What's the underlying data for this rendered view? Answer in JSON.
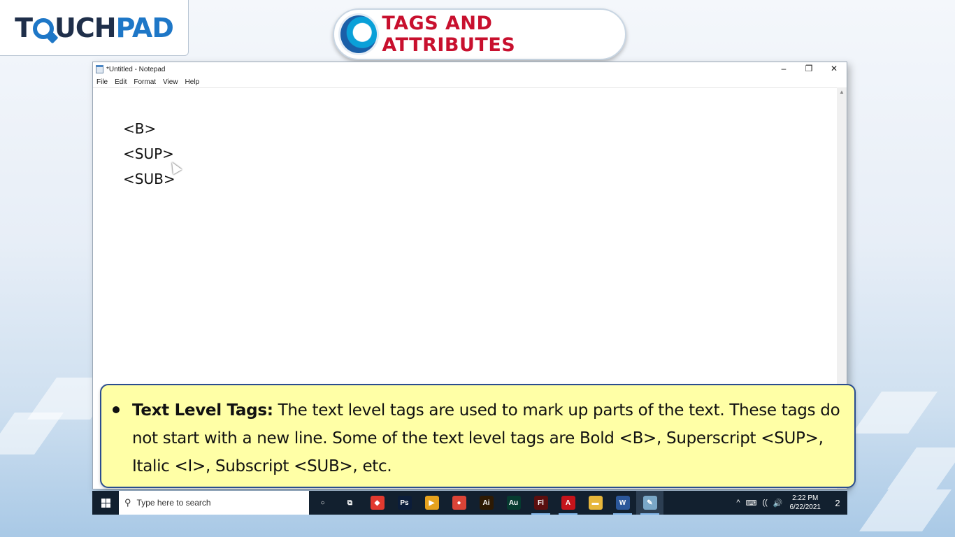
{
  "brand": {
    "logo_prefix": "T",
    "logo_mid": "UCH",
    "logo_suffix": "PAD"
  },
  "slide": {
    "title": "TAGS AND ATTRIBUTES"
  },
  "notepad": {
    "title": "*Untitled - Notepad",
    "menu": [
      "File",
      "Edit",
      "Format",
      "View",
      "Help"
    ],
    "lines": [
      "<B>",
      "<SUP>",
      "<SUB>"
    ],
    "controls": {
      "minimize": "–",
      "restore": "❐",
      "close": "✕"
    }
  },
  "callout": {
    "term": "Text Level Tags:",
    "body": " The text level tags are used to mark up parts of the text. These tags do not start with a new line. Some of the text level tags are Bold <B>, Superscript <SUP>, Italic <I>, Subscript <SUB>, etc."
  },
  "taskbar": {
    "search_placeholder": "Type here to search",
    "apps": [
      {
        "name": "cortana",
        "label": "○",
        "color": "transparent",
        "open": false
      },
      {
        "name": "task-view",
        "label": "⧉",
        "color": "transparent",
        "open": false
      },
      {
        "name": "anydesk",
        "label": "◆",
        "color": "#e23a2f",
        "open": false
      },
      {
        "name": "photoshop",
        "label": "Ps",
        "color": "#0b1d3a",
        "open": false
      },
      {
        "name": "media-player",
        "label": "▶",
        "color": "#e6a21d",
        "open": false
      },
      {
        "name": "chrome",
        "label": "●",
        "color": "#db4437",
        "open": false
      },
      {
        "name": "illustrator",
        "label": "Ai",
        "color": "#2d1a03",
        "open": false
      },
      {
        "name": "audition",
        "label": "Au",
        "color": "#063a2f",
        "open": false
      },
      {
        "name": "flash",
        "label": "Fl",
        "color": "#5a0f0f",
        "open": true
      },
      {
        "name": "acrobat",
        "label": "A",
        "color": "#c5141b",
        "open": true
      },
      {
        "name": "file-explorer",
        "label": "▬",
        "color": "#e7b73b",
        "open": false
      },
      {
        "name": "word",
        "label": "W",
        "color": "#2b579a",
        "open": true
      },
      {
        "name": "notepad",
        "label": "✎",
        "color": "#7aa7c7",
        "open": true
      }
    ],
    "tray_icons": [
      "^",
      "⌨",
      "((",
      "🔊"
    ],
    "time": "2:22 PM",
    "date": "6/22/2021",
    "notification_count": "2"
  },
  "colors": {
    "title_red": "#c8102e",
    "brand_blue": "#1e77c7",
    "callout_bg": "#ffffa6",
    "callout_border": "#2a4d8f",
    "taskbar": "#12202f"
  }
}
